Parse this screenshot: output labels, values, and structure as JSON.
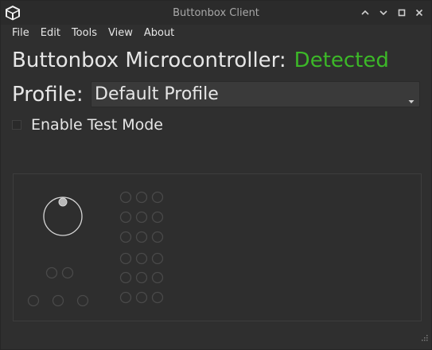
{
  "window": {
    "title": "Buttonbox Client",
    "icons": {
      "app": "cube-icon",
      "minimize": "chevron-up-icon",
      "restore": "chevron-down-icon",
      "maximize": "maximize-icon",
      "close": "close-icon"
    }
  },
  "menu": {
    "items": [
      "File",
      "Edit",
      "Tools",
      "View",
      "About"
    ]
  },
  "status": {
    "label": "Buttonbox Microcontroller:",
    "value": "Detected",
    "value_color": "#3cb828"
  },
  "profile": {
    "label": "Profile:",
    "selected": "Default Profile"
  },
  "test_mode": {
    "label": "Enable Test Mode",
    "checked": false
  },
  "colors": {
    "background": "#2f2f2f",
    "text": "#e6e6e6",
    "accent": "#3cb828"
  }
}
